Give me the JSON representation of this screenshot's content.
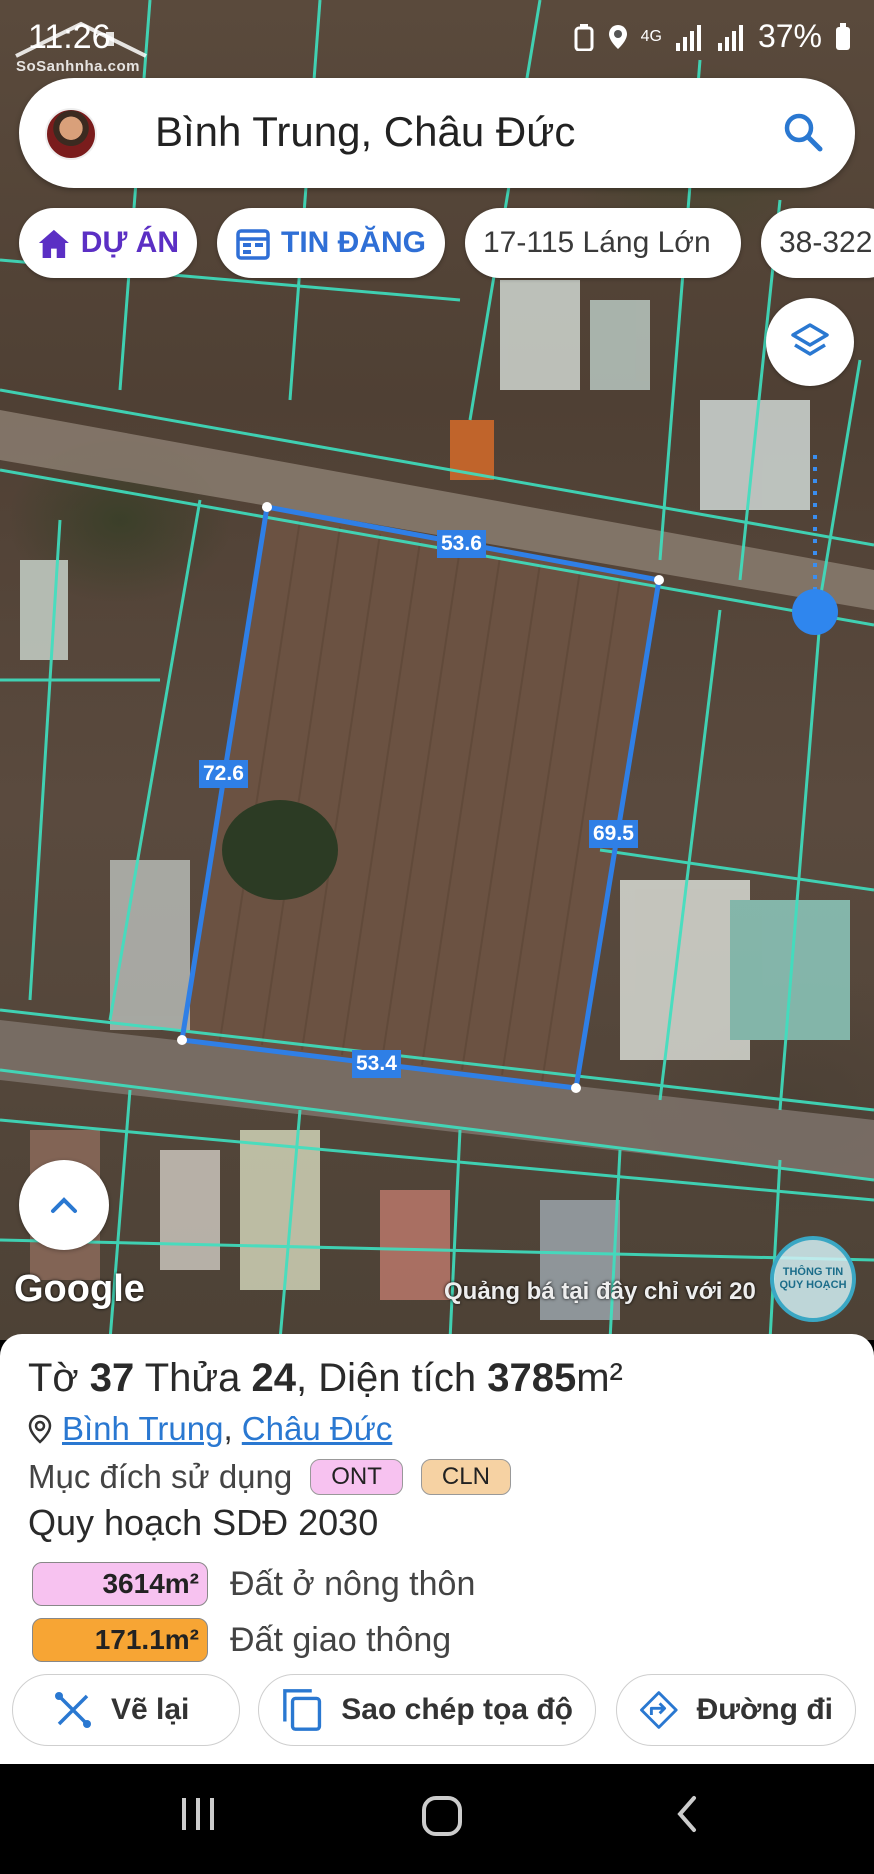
{
  "status_bar": {
    "time": "11:26",
    "network": "4G",
    "battery": "37%"
  },
  "watermark": {
    "text": "SoSanhnha.com"
  },
  "search": {
    "query": "Bình Trung, Châu Đức"
  },
  "chips": [
    {
      "label": "DỰ ÁN",
      "icon": "home-icon"
    },
    {
      "label": "TIN ĐĂNG",
      "icon": "calendar-icon"
    },
    {
      "label": "17-115 Láng Lớn"
    },
    {
      "label": "38-322"
    }
  ],
  "map": {
    "measurements": {
      "top": "53.6",
      "left": "72.6",
      "right": "69.5",
      "bottom": "53.4"
    },
    "attribution": "Google",
    "ad_text": "Quảng bá tại đây chỉ với 20",
    "planning_badge": "THÔNG TIN QUY HOẠCH"
  },
  "parcel": {
    "title_prefix": "Tờ",
    "sheet_no": "37",
    "parcel_word": "Thửa",
    "parcel_no": "24",
    "area_word": ", Diện tích",
    "area": "3785",
    "area_unit": "m²",
    "location": {
      "ward": "Bình Trung",
      "separator": ",",
      "district": "Châu Đức"
    },
    "purpose_label": "Mục đích sử dụng",
    "purpose_codes": [
      "ONT",
      "CLN"
    ],
    "plan_label": "Quy hoạch SDĐ 2030",
    "plan_items": [
      {
        "area": "3614m²",
        "label": "Đất ở nông thôn",
        "color": "#f7c2f0"
      },
      {
        "area": "171.1m²",
        "label": "Đất giao thông",
        "color": "#f7a534"
      }
    ]
  },
  "actions": {
    "redraw": "Vẽ lại",
    "copy": "Sao chép tọa độ",
    "route": "Đường đi"
  },
  "colors": {
    "parcel_line": "#2f7fe6",
    "cadastral_line": "#3ee0c0",
    "accent": "#2a78d1"
  }
}
